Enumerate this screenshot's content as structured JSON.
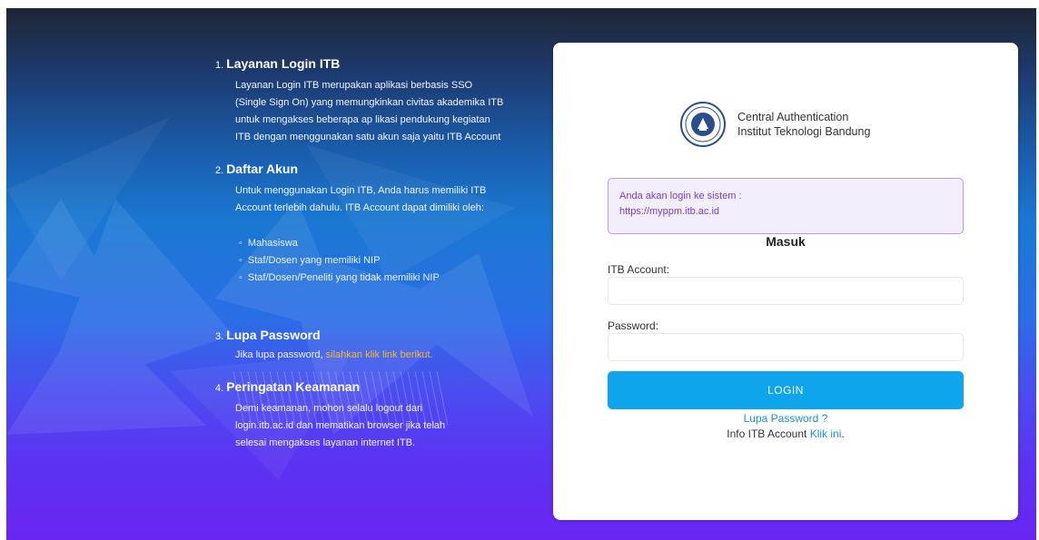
{
  "info": {
    "sections": [
      {
        "number": "1.",
        "title": "Layanan Login ITB",
        "body": "Layanan Login ITB merupakan aplikasi berbasis SSO (Single Sign On) yang memungkinkan civitas akademika ITB untuk mengakses beberapa ap likasi pendukung kegiatan ITB dengan menggunakan satu akun saja yaitu ITB Account"
      },
      {
        "number": "2.",
        "title": "Daftar Akun",
        "body": "Untuk menggunakan Login ITB, Anda harus memiliki ITB Account terlebih dahulu. ITB Account dapat dimiliki oleh:",
        "items": [
          "Mahasiswa",
          "Staf/Dosen yang memiliki NIP",
          "Staf/Dosen/Peneliti yang tidak memiliki NIP"
        ]
      },
      {
        "number": "3.",
        "title": "Lupa Password",
        "body_prefix": "Jika lupa password,",
        "link": "silahkan klik link berikut."
      },
      {
        "number": "4.",
        "title": "Peringatan Keamanan",
        "body": "Demi keamanan, mohon selalu logout dari login.itb.ac.id dan mematikan browser jika telah selesai mengakses layanan internet ITB."
      }
    ]
  },
  "card": {
    "brand_line1": "Central Authentication",
    "brand_line2": "Institut Teknologi Bandung",
    "notice_line1": "Anda akan login ke sistem :",
    "notice_line2": "https://myppm.itb.ac.id",
    "heading": "Masuk",
    "account_label": "ITB Account:",
    "account_value": "",
    "password_label": "Password:",
    "password_value": "",
    "login_button": "LOGIN",
    "forgot_link": "Lupa Password ?",
    "info_text": "Info ITB Account",
    "info_link": "Klik ini",
    "info_suffix": "."
  },
  "icons": {
    "seal": "itb-seal-icon"
  },
  "colors": {
    "accent": "#0ea5ec",
    "notice_text": "#7a3fc6",
    "link": "#1a8fd0",
    "orange_link": "#f5b82e"
  }
}
